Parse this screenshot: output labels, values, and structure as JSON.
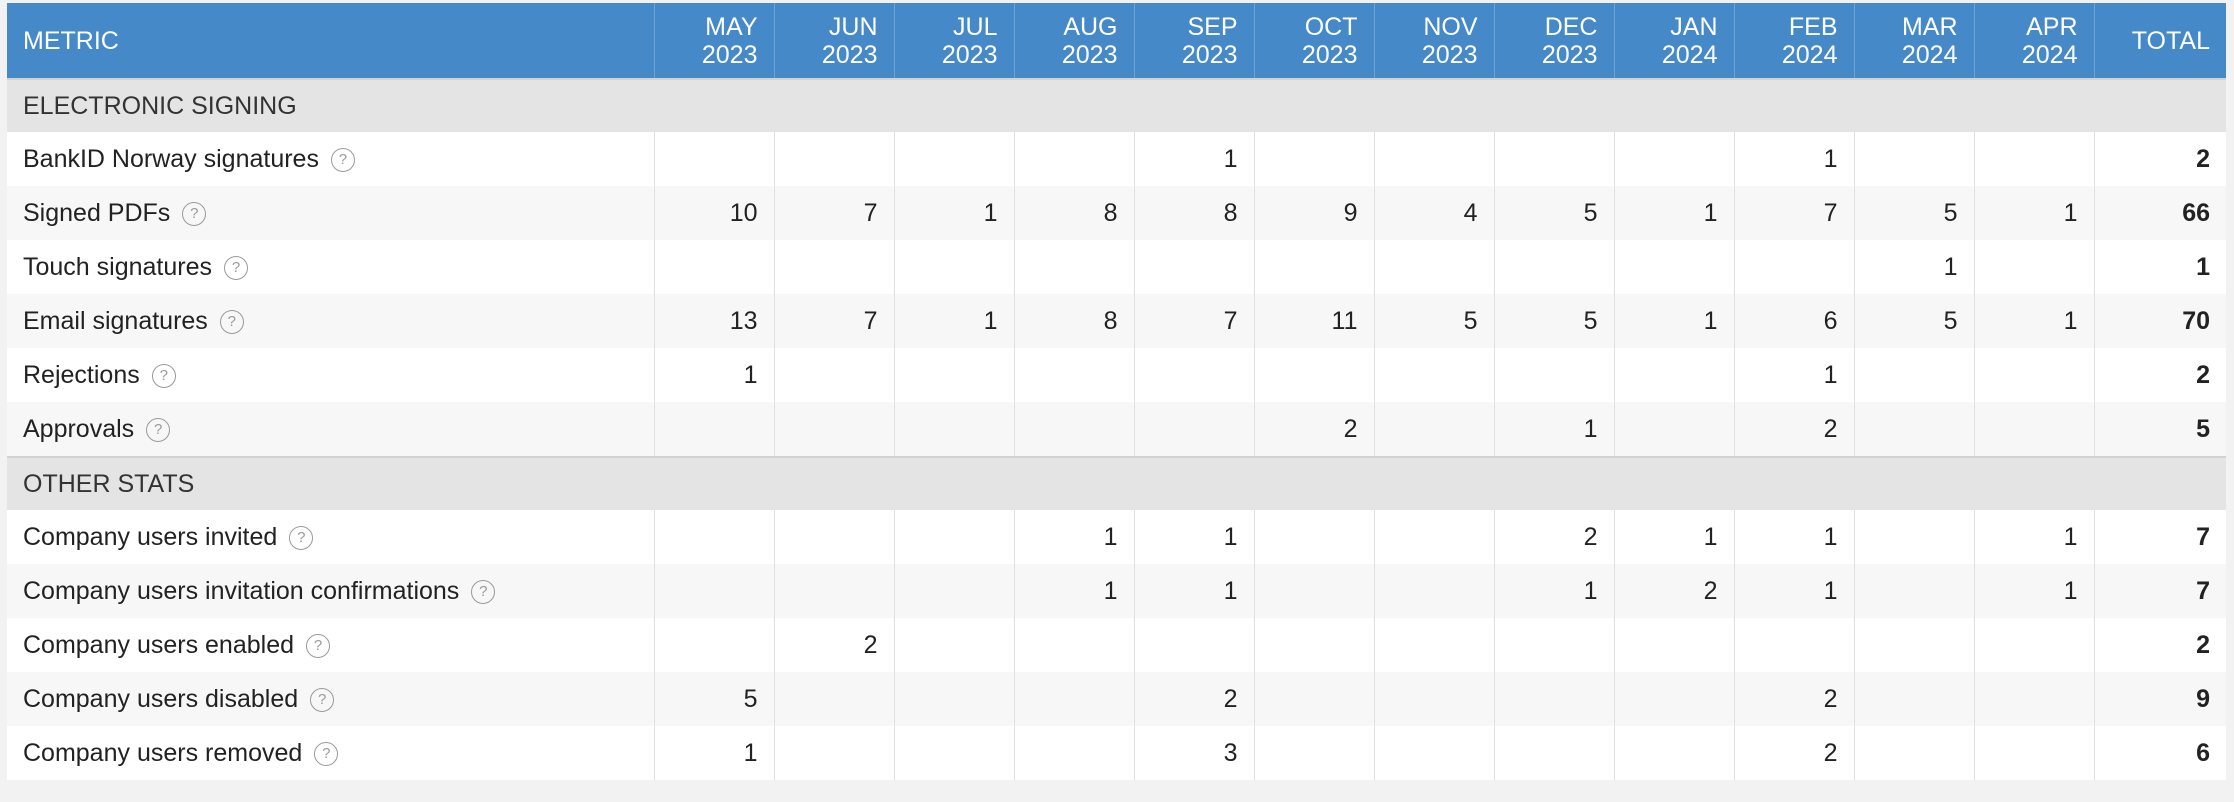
{
  "header": {
    "metric_label": "METRIC",
    "months": [
      {
        "m": "MAY",
        "y": "2023"
      },
      {
        "m": "JUN",
        "y": "2023"
      },
      {
        "m": "JUL",
        "y": "2023"
      },
      {
        "m": "AUG",
        "y": "2023"
      },
      {
        "m": "SEP",
        "y": "2023"
      },
      {
        "m": "OCT",
        "y": "2023"
      },
      {
        "m": "NOV",
        "y": "2023"
      },
      {
        "m": "DEC",
        "y": "2023"
      },
      {
        "m": "JAN",
        "y": "2024"
      },
      {
        "m": "FEB",
        "y": "2024"
      },
      {
        "m": "MAR",
        "y": "2024"
      },
      {
        "m": "APR",
        "y": "2024"
      }
    ],
    "total_label": "TOTAL"
  },
  "help_icon": "?",
  "sections": [
    {
      "title": "ELECTRONIC SIGNING",
      "rows": [
        {
          "name": "BankID Norway signatures",
          "values": [
            "",
            "",
            "",
            "",
            "1",
            "",
            "",
            "",
            "",
            "1",
            "",
            ""
          ],
          "total": "2"
        },
        {
          "name": "Signed PDFs",
          "values": [
            "10",
            "7",
            "1",
            "8",
            "8",
            "9",
            "4",
            "5",
            "1",
            "7",
            "5",
            "1"
          ],
          "total": "66"
        },
        {
          "name": "Touch signatures",
          "values": [
            "",
            "",
            "",
            "",
            "",
            "",
            "",
            "",
            "",
            "",
            "1",
            ""
          ],
          "total": "1"
        },
        {
          "name": "Email signatures",
          "values": [
            "13",
            "7",
            "1",
            "8",
            "7",
            "11",
            "5",
            "5",
            "1",
            "6",
            "5",
            "1"
          ],
          "total": "70"
        },
        {
          "name": "Rejections",
          "values": [
            "1",
            "",
            "",
            "",
            "",
            "",
            "",
            "",
            "",
            "1",
            "",
            ""
          ],
          "total": "2"
        },
        {
          "name": "Approvals",
          "values": [
            "",
            "",
            "",
            "",
            "",
            "2",
            "",
            "1",
            "",
            "2",
            "",
            ""
          ],
          "total": "5"
        }
      ]
    },
    {
      "title": "OTHER STATS",
      "rows": [
        {
          "name": "Company users invited",
          "values": [
            "",
            "",
            "",
            "1",
            "1",
            "",
            "",
            "2",
            "1",
            "1",
            "",
            "1"
          ],
          "total": "7"
        },
        {
          "name": "Company users invitation confirmations",
          "values": [
            "",
            "",
            "",
            "1",
            "1",
            "",
            "",
            "1",
            "2",
            "1",
            "",
            "1"
          ],
          "total": "7"
        },
        {
          "name": "Company users enabled",
          "values": [
            "",
            "2",
            "",
            "",
            "",
            "",
            "",
            "",
            "",
            "",
            "",
            ""
          ],
          "total": "2"
        },
        {
          "name": "Company users disabled",
          "values": [
            "5",
            "",
            "",
            "",
            "2",
            "",
            "",
            "",
            "",
            "2",
            "",
            ""
          ],
          "total": "9"
        },
        {
          "name": "Company users removed",
          "values": [
            "1",
            "",
            "",
            "",
            "3",
            "",
            "",
            "",
            "",
            "2",
            "",
            ""
          ],
          "total": "6"
        }
      ]
    }
  ]
}
